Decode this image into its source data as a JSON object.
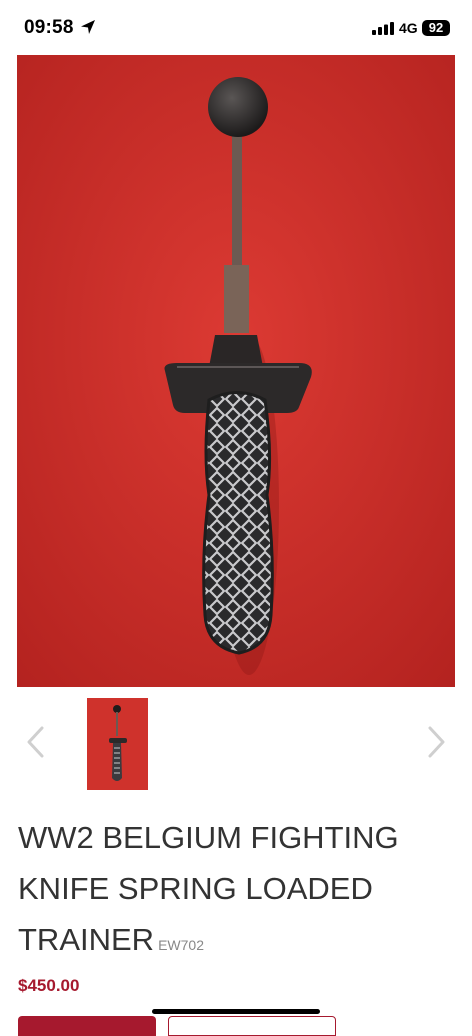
{
  "status_bar": {
    "time": "09:58",
    "network": "4G",
    "battery": "92"
  },
  "product": {
    "title": "WW2 BELGIUM FIGHTING KNIFE SPRING LOADED TRAINER",
    "sku": "EW702",
    "price": "$450.00"
  },
  "colors": {
    "accent": "#a6192e",
    "photo_background": "#d0312c"
  }
}
